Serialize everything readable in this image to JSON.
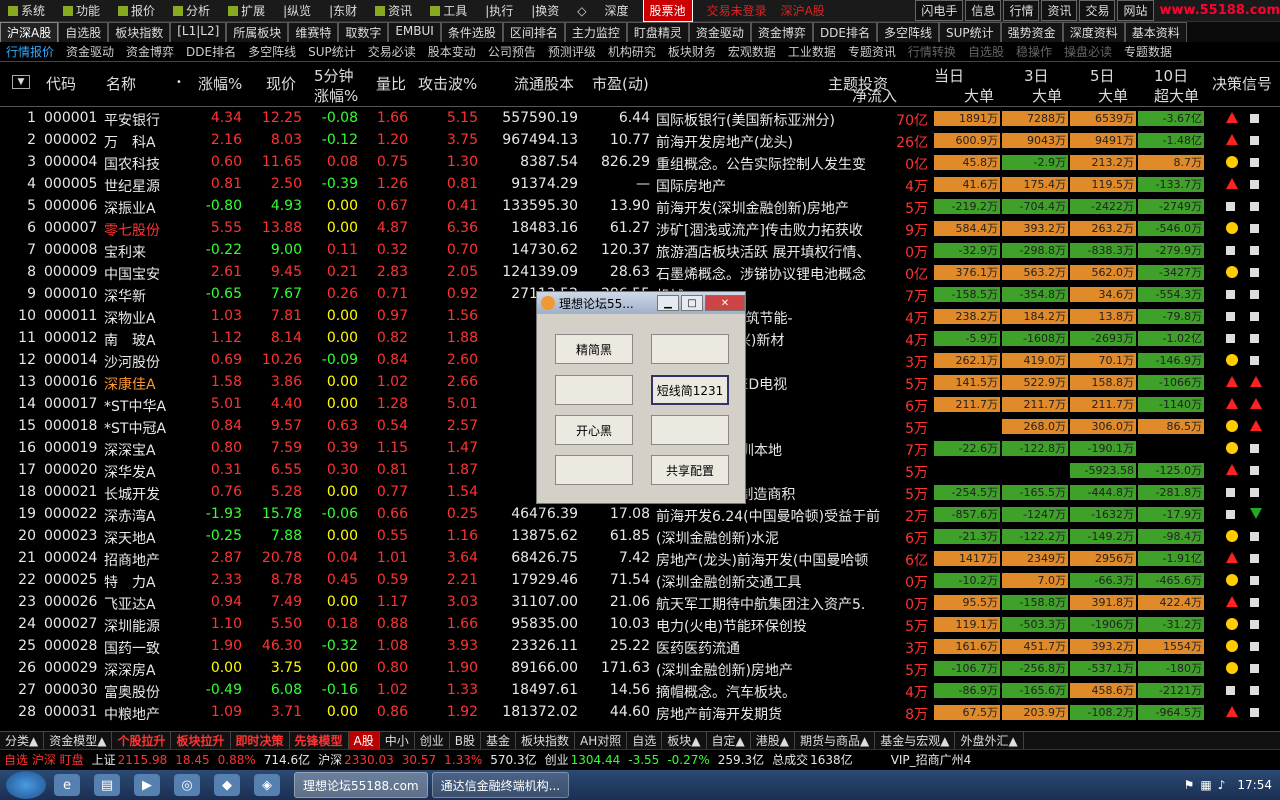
{
  "menu": {
    "items": [
      "系统",
      "功能",
      "报价",
      "分析",
      "扩展",
      "|纵览",
      "|东财",
      "资讯",
      "工具",
      "|执行",
      "|换资",
      "◇",
      "深度"
    ],
    "highlight": "股票池",
    "status1": "交易未登录",
    "status2": "深沪A股",
    "right_buttons": [
      "闪电手",
      "信息",
      "行情",
      "资讯",
      "交易",
      "网站"
    ],
    "brand": "www.55188.com"
  },
  "toolbar1": [
    "沪深A股",
    "自选股",
    "板块指数",
    "[L1|L2]",
    "所属板块",
    "维赛特",
    "取数字",
    "EMBUI",
    "条件选股",
    "区间排名",
    "主力监控",
    "盯盘精灵",
    "资金驱动",
    "资金博弈",
    "DDE排名",
    "多空阵线",
    "SUP统计",
    "强势资金",
    "深度资料",
    "基本资料"
  ],
  "toolbar2": [
    "行情报价",
    "资金驱动",
    "资金博弈",
    "DDE排名",
    "多空阵线",
    "SUP统计",
    "交易必读",
    "股本变动",
    "公司预告",
    "预测评级",
    "机构研究",
    "板块财务",
    "宏观数据",
    "工业数据",
    "专题资讯",
    "行情转换",
    "自选股",
    "稳操作",
    "操盘必读",
    "专题数据"
  ],
  "header": {
    "code": "代码",
    "name": "名称",
    "change": "涨幅%",
    "price": "现价",
    "min5a": "5分钟",
    "min5b": "涨幅%",
    "vol_ratio": "量比",
    "attack": "攻击波%",
    "float": "流通股本",
    "pe": "市盈(动)",
    "theme": "主题投资",
    "today": "当日",
    "d3": "3日",
    "d5": "5日",
    "d10": "10日",
    "net": "净流入",
    "big1": "大单",
    "big3": "大单",
    "big5": "大单",
    "superbig": "超大单",
    "signal": "决策信号"
  },
  "rows": [
    {
      "n": "1",
      "code": "000001",
      "name": "平安银行",
      "chg": "4.34",
      "price": "12.25",
      "m5": "-0.08",
      "vr": "1.66",
      "atk": "5.15",
      "flt": "557590.19",
      "pe": "6.44",
      "theme": "国际板银行(美国新标亚洲分)",
      "net": "70亿",
      "b1": "1891万",
      "b3": "7288万",
      "b5": "6539万",
      "sb": "-3.67亿",
      "c": "red",
      "sig": [
        "tri-up",
        "sq"
      ]
    },
    {
      "n": "2",
      "code": "000002",
      "name": "万　科A",
      "chg": "2.16",
      "price": "8.03",
      "m5": "-0.12",
      "vr": "1.20",
      "atk": "3.75",
      "flt": "967494.13",
      "pe": "10.77",
      "theme": "前海开发房地产(龙头)",
      "net": "26亿",
      "b1": "600.9万",
      "b3": "9043万",
      "b5": "9491万",
      "sb": "-1.48亿",
      "c": "red",
      "sig": [
        "tri-up",
        "sq"
      ]
    },
    {
      "n": "3",
      "code": "000004",
      "name": "国农科技",
      "chg": "0.60",
      "price": "11.65",
      "m5": "0.08",
      "vr": "0.75",
      "atk": "1.30",
      "flt": "8387.54",
      "pe": "826.29",
      "theme": "重组概念。公告实际控制人发生变",
      "net": "0亿",
      "b1": "45.8万",
      "b3": "-2.9万",
      "b5": "213.2万",
      "sb": "8.7万",
      "c": "red",
      "sig": [
        "dot",
        "sq"
      ]
    },
    {
      "n": "4",
      "code": "000005",
      "name": "世纪星源",
      "chg": "0.81",
      "price": "2.50",
      "m5": "-0.39",
      "vr": "1.26",
      "atk": "0.81",
      "flt": "91374.29",
      "pe": "—",
      "theme": "国际房地产",
      "net": "4万",
      "b1": "41.6万",
      "b3": "175.4万",
      "b5": "119.5万",
      "sb": "-133.7万",
      "c": "red",
      "sig": [
        "tri-up",
        "sq"
      ]
    },
    {
      "n": "5",
      "code": "000006",
      "name": "深振业A",
      "chg": "-0.80",
      "price": "4.93",
      "m5": "0.00",
      "vr": "0.67",
      "atk": "0.41",
      "flt": "133595.30",
      "pe": "13.90",
      "theme": "前海开发(深圳金融创新)房地产",
      "net": "5万",
      "b1": "-219.2万",
      "b3": "-704.4万",
      "b5": "-2422万",
      "sb": "-2749万",
      "c": "green",
      "sig": [
        "sq",
        "sq"
      ]
    },
    {
      "n": "6",
      "code": "000007",
      "name": "零七股份",
      "chg": "5.55",
      "price": "13.88",
      "m5": "0.00",
      "vr": "4.87",
      "atk": "6.36",
      "flt": "18483.16",
      "pe": "61.27",
      "theme": "涉矿[涸浅或流产]传击败力拓获收",
      "net": "9万",
      "b1": "584.4万",
      "b3": "393.2万",
      "b5": "263.2万",
      "sb": "-546.0万",
      "c": "red",
      "sig": [
        "dot",
        "sq"
      ]
    },
    {
      "n": "7",
      "code": "000008",
      "name": "宝利来",
      "chg": "-0.22",
      "price": "9.00",
      "m5": "0.11",
      "vr": "0.32",
      "atk": "0.70",
      "flt": "14730.62",
      "pe": "120.37",
      "theme": "旅游酒店板块活跃 展开填权行情、",
      "net": "0万",
      "b1": "-32.9万",
      "b3": "-298.8万",
      "b5": "-838.3万",
      "sb": "-279.9万",
      "c": "green",
      "sig": [
        "sq",
        "sq"
      ]
    },
    {
      "n": "8",
      "code": "000009",
      "name": "中国宝安",
      "chg": "2.61",
      "price": "9.45",
      "m5": "0.21",
      "vr": "2.83",
      "atk": "2.05",
      "flt": "124139.09",
      "pe": "28.63",
      "theme": "石墨烯概念。涉锑协议锂电池概念",
      "net": "0亿",
      "b1": "376.1万",
      "b3": "563.2万",
      "b5": "562.0万",
      "sb": "-3427万",
      "c": "red",
      "sig": [
        "dot",
        "sq"
      ]
    },
    {
      "n": "9",
      "code": "000010",
      "name": "深华新",
      "chg": "-0.65",
      "price": "7.67",
      "m5": "0.26",
      "vr": "0.71",
      "atk": "0.92",
      "flt": "27113.52",
      "pe": "286.55",
      "theme": "机械",
      "net": "7万",
      "b1": "-158.5万",
      "b3": "-354.8万",
      "b5": "34.6万",
      "sb": "-554.3万",
      "c": "green",
      "sig": [
        "sq",
        "sq"
      ]
    },
    {
      "n": "10",
      "code": "000011",
      "name": "深物业A",
      "chg": "1.03",
      "price": "7.81",
      "m5": "0.00",
      "vr": "0.97",
      "atk": "1.56",
      "flt": "17",
      "pe": "",
      "theme": "圳金融创新)建筑节能-",
      "net": "4万",
      "b1": "238.2万",
      "b3": "184.2万",
      "b5": "13.8万",
      "sb": "-79.8万",
      "c": "red",
      "sig": [
        "sq",
        "sq"
      ]
    },
    {
      "n": "11",
      "code": "000012",
      "name": "南　玻A",
      "chg": "1.12",
      "price": "8.14",
      "m5": "0.00",
      "vr": "0.82",
      "atk": "1.88",
      "flt": "130",
      "pe": "",
      "theme": "(节能环保(七兴)新材",
      "net": "4万",
      "b1": "-5.9万",
      "b3": "-1608万",
      "b5": "-2693万",
      "sb": "-1.02亿",
      "c": "red",
      "sig": [
        "sq",
        "sq"
      ]
    },
    {
      "n": "12",
      "code": "000014",
      "name": "沙河股份",
      "chg": "0.69",
      "price": "10.26",
      "m5": "-0.09",
      "vr": "0.84",
      "atk": "2.60",
      "flt": "20",
      "pe": "",
      "theme": "新)房地产",
      "net": "3万",
      "b1": "262.1万",
      "b3": "419.0万",
      "b5": "70.1万",
      "sb": "-146.9万",
      "c": "red",
      "sig": [
        "dot",
        "sq"
      ]
    },
    {
      "n": "13",
      "code": "000016",
      "name": "深康佳A",
      "chg": "1.58",
      "price": "3.86",
      "m5": "0.00",
      "vr": "1.02",
      "atk": "2.66",
      "flt": "59",
      "pe": "",
      "theme": "3D电视机，LED电视",
      "net": "5万",
      "b1": "141.5万",
      "b3": "522.9万",
      "b5": "158.8万",
      "sb": "-1066万",
      "c": "red",
      "nameColor": "orange",
      "sig": [
        "tri-up",
        "tri-up"
      ]
    },
    {
      "n": "14",
      "code": "000017",
      "name": "*ST中华A",
      "chg": "5.01",
      "price": "4.40",
      "m5": "0.00",
      "vr": "1.28",
      "atk": "5.01",
      "flt": "30",
      "pe": "",
      "theme": "，自行车",
      "net": "6万",
      "b1": "211.7万",
      "b3": "211.7万",
      "b5": "211.7万",
      "sb": "-1140万",
      "c": "red",
      "sig": [
        "tri-up",
        "tri-up"
      ]
    },
    {
      "n": "15",
      "code": "000018",
      "name": "*ST中冠A",
      "chg": "0.84",
      "price": "9.57",
      "m5": "0.63",
      "vr": "0.54",
      "atk": "2.57",
      "flt": "9",
      "pe": "",
      "theme": "，印染",
      "net": "5万",
      "b1": "",
      "b3": "268.0万",
      "b5": "306.0万",
      "sb": "86.5万",
      "c": "red",
      "sig": [
        "dot",
        "tri-up"
      ]
    },
    {
      "n": "16",
      "code": "000019",
      "name": "深深宝A",
      "chg": "0.80",
      "price": "7.59",
      "m5": "0.39",
      "vr": "1.15",
      "atk": "1.47",
      "flt": "20",
      "pe": "",
      "theme": "及茶饮料，深圳本地",
      "net": "7万",
      "b1": "-22.6万",
      "b3": "-122.8万",
      "b5": "-190.1万",
      "sb": "",
      "c": "red",
      "sig": [
        "dot",
        "sq"
      ]
    },
    {
      "n": "17",
      "code": "000020",
      "name": "深华发A",
      "chg": "0.31",
      "price": "6.55",
      "m5": "0.30",
      "vr": "0.81",
      "atk": "1.87",
      "flt": "6",
      "pe": "",
      "theme": "新)电子信息",
      "net": "5万",
      "b1": "",
      "b3": "",
      "b5": "-5923.58",
      "sb": "-125.0万",
      "c": "red",
      "sig": [
        "tri-up",
        "sq"
      ]
    },
    {
      "n": "18",
      "code": "000021",
      "name": "长城开发",
      "chg": "0.76",
      "price": "5.28",
      "m5": "0.00",
      "vr": "0.77",
      "atk": "1.54",
      "flt": "131",
      "pe": "",
      "theme": "LED固态光源制造商积",
      "net": "5万",
      "b1": "-254.5万",
      "b3": "-165.5万",
      "b5": "-444.8万",
      "sb": "-281.8万",
      "c": "red",
      "sig": [
        "sq",
        "sq"
      ]
    },
    {
      "n": "19",
      "code": "000022",
      "name": "深赤湾A",
      "chg": "-1.93",
      "price": "15.78",
      "m5": "-0.06",
      "vr": "0.66",
      "atk": "0.25",
      "flt": "46476.39",
      "pe": "17.08",
      "theme": "前海开发6.24(中国曼哈顿)受益于前",
      "net": "2万",
      "b1": "-857.6万",
      "b3": "-1247万",
      "b5": "-1632万",
      "sb": "-17.9万",
      "c": "green",
      "sig": [
        "sq",
        "tri-dn"
      ]
    },
    {
      "n": "20",
      "code": "000023",
      "name": "深天地A",
      "chg": "-0.25",
      "price": "7.88",
      "m5": "0.00",
      "vr": "0.55",
      "atk": "1.16",
      "flt": "13875.62",
      "pe": "61.85",
      "theme": "(深圳金融创新)水泥",
      "net": "6万",
      "b1": "-21.3万",
      "b3": "-122.2万",
      "b5": "-149.2万",
      "sb": "-98.4万",
      "c": "green",
      "sig": [
        "dot",
        "sq"
      ]
    },
    {
      "n": "21",
      "code": "000024",
      "name": "招商地产",
      "chg": "2.87",
      "price": "20.78",
      "m5": "0.04",
      "vr": "1.01",
      "atk": "3.64",
      "flt": "68426.75",
      "pe": "7.42",
      "theme": "房地产(龙头)前海开发(中国曼哈顿",
      "net": "6亿",
      "b1": "1417万",
      "b3": "2349万",
      "b5": "2956万",
      "sb": "-1.91亿",
      "c": "red",
      "sig": [
        "tri-up",
        "sq"
      ]
    },
    {
      "n": "22",
      "code": "000025",
      "name": "特　力A",
      "chg": "2.33",
      "price": "8.78",
      "m5": "0.45",
      "vr": "0.59",
      "atk": "2.21",
      "flt": "17929.46",
      "pe": "71.54",
      "theme": "(深圳金融创新交通工具",
      "net": "0万",
      "b1": "-10.2万",
      "b3": "7.0万",
      "b5": "-66.3万",
      "sb": "-465.6万",
      "c": "red",
      "sig": [
        "dot",
        "sq"
      ]
    },
    {
      "n": "23",
      "code": "000026",
      "name": "飞亚达A",
      "chg": "0.94",
      "price": "7.49",
      "m5": "0.00",
      "vr": "1.17",
      "atk": "3.03",
      "flt": "31107.00",
      "pe": "21.06",
      "theme": "航天军工期待中航集团注入资产5.",
      "net": "0万",
      "b1": "95.5万",
      "b3": "-158.8万",
      "b5": "391.8万",
      "sb": "422.4万",
      "c": "red",
      "sig": [
        "tri-up",
        "sq"
      ]
    },
    {
      "n": "24",
      "code": "000027",
      "name": "深圳能源",
      "chg": "1.10",
      "price": "5.50",
      "m5": "0.18",
      "vr": "0.88",
      "atk": "1.66",
      "flt": "95835.00",
      "pe": "10.03",
      "theme": "电力(火电)节能环保创投",
      "net": "5万",
      "b1": "119.1万",
      "b3": "-503.3万",
      "b5": "-1906万",
      "sb": "-31.2万",
      "c": "red",
      "sig": [
        "dot",
        "sq"
      ]
    },
    {
      "n": "25",
      "code": "000028",
      "name": "国药一致",
      "chg": "1.90",
      "price": "46.30",
      "m5": "-0.32",
      "vr": "1.08",
      "atk": "3.93",
      "flt": "23326.11",
      "pe": "25.22",
      "theme": "医药医药流通",
      "net": "3万",
      "b1": "161.6万",
      "b3": "451.7万",
      "b5": "393.2万",
      "sb": "1554万",
      "c": "red",
      "sig": [
        "dot",
        "sq"
      ]
    },
    {
      "n": "26",
      "code": "000029",
      "name": "深深房A",
      "chg": "0.00",
      "price": "3.75",
      "m5": "0.00",
      "vr": "0.80",
      "atk": "1.90",
      "flt": "89166.00",
      "pe": "171.63",
      "theme": "(深圳金融创新)房地产",
      "net": "5万",
      "b1": "-106.7万",
      "b3": "-256.8万",
      "b5": "-537.1万",
      "sb": "-180万",
      "c": "yellow",
      "sig": [
        "dot",
        "sq"
      ]
    },
    {
      "n": "27",
      "code": "000030",
      "name": "富奥股份",
      "chg": "-0.49",
      "price": "6.08",
      "m5": "-0.16",
      "vr": "1.02",
      "atk": "1.33",
      "flt": "18497.61",
      "pe": "14.56",
      "theme": "摘帽概念。汽车板块。",
      "net": "4万",
      "b1": "-86.9万",
      "b3": "-165.6万",
      "b5": "458.6万",
      "sb": "-2121万",
      "c": "green",
      "sig": [
        "sq",
        "sq"
      ]
    },
    {
      "n": "28",
      "code": "000031",
      "name": "中粮地产",
      "chg": "1.09",
      "price": "3.71",
      "m5": "0.00",
      "vr": "0.86",
      "atk": "1.92",
      "flt": "181372.02",
      "pe": "44.60",
      "theme": "房地产前海开发期货",
      "net": "8万",
      "b1": "67.5万",
      "b3": "203.9万",
      "b5": "-108.2万",
      "sb": "-964.5万",
      "c": "red",
      "sig": [
        "tri-up",
        "sq"
      ]
    }
  ],
  "bottom_tabs": [
    "分类▲",
    "资金模型▲",
    "个股拉升",
    "板块拉升",
    "即时决策",
    "先锋模型",
    "A股",
    "中小",
    "创业",
    "B股",
    "基金",
    "板块指数",
    "AH对照",
    "自选",
    "板块▲",
    "自定▲",
    "港股▲",
    "期货与商品▲",
    "基金与宏观▲",
    "外盘外汇▲"
  ],
  "status": {
    "market": "自选 沪深 盯盘",
    "sh_label": "上证",
    "sh_val": "2115.98",
    "sh_chg": "18.45",
    "sh_pct": "0.88%",
    "sh_amt": "714.6亿",
    "sz_label": "沪深",
    "sz_val": "2330.03",
    "sz_chg": "30.57",
    "sz_pct": "1.33%",
    "sz_amt": "570.3亿",
    "cy_label": "创业",
    "cy_val": "1304.44",
    "cy_chg": "-3.55",
    "cy_pct": "-0.27%",
    "cy_amt": "259.3亿",
    "total_label": "总成交",
    "total": "1638亿",
    "vip": "VIP_招商广州4"
  },
  "taskbar": {
    "tasks": [
      "理想论坛55188.com",
      "通达信金融终端机构..."
    ],
    "time": "17:54"
  },
  "dialog": {
    "title": "理想论坛55...",
    "buttons": [
      "精简黑",
      "",
      "",
      "短线简1231",
      "开心黑",
      "",
      "",
      "共享配置"
    ]
  }
}
